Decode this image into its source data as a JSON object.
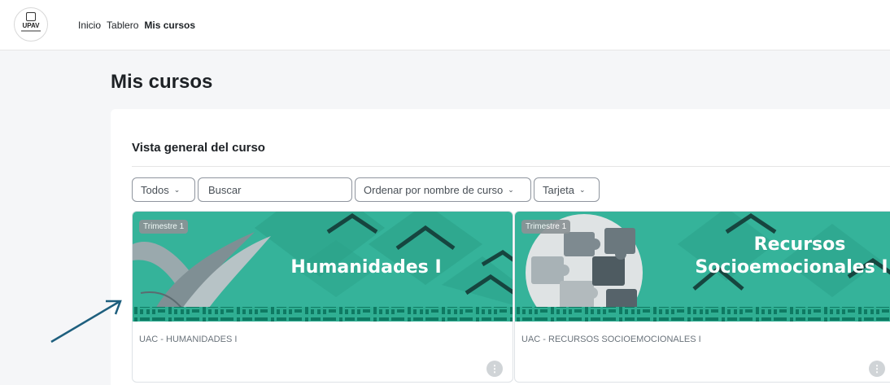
{
  "header": {
    "logo_text": "UPAV",
    "nav": [
      "Inicio",
      "Tablero",
      "Mis cursos"
    ]
  },
  "page": {
    "title": "Mis cursos"
  },
  "overview": {
    "title": "Vista general del curso",
    "filter_label": "Todos",
    "search_placeholder": "Buscar",
    "sort_label": "Ordenar por nombre de curso",
    "view_label": "Tarjeta"
  },
  "courses": [
    {
      "badge": "Trimestre 1",
      "banner_title": "Humanidades I",
      "name": "UAC - HUMANIDADES I"
    },
    {
      "badge": "Trimestre 1",
      "banner_title_line1": "Recursos",
      "banner_title_line2": "Socioemocionales I",
      "name": "UAC - RECURSOS SOCIOEMOCIONALES I"
    }
  ],
  "colors": {
    "banner": "#2fae92",
    "banner_dark": "#16846d",
    "accent_arrow": "#1e5f7e"
  },
  "icons": [
    "more-options-icon",
    "chevron-down-icon",
    "annotation-arrow"
  ]
}
